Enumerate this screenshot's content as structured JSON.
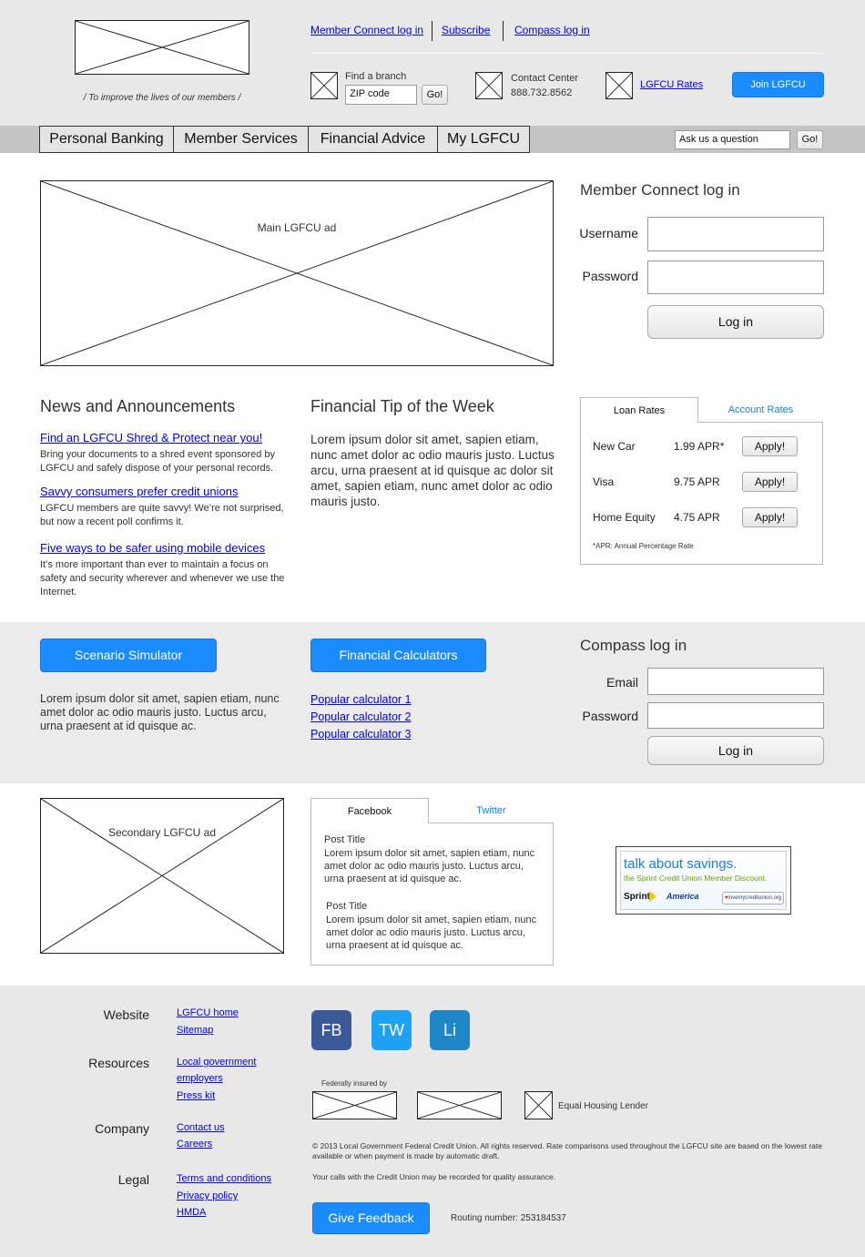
{
  "header": {
    "logo_tagline": "/ To improve the lives of our members /",
    "top_links": [
      "Member Connect log in",
      "Subscribe",
      "Compass log in"
    ],
    "find_branch_label": "Find a branch",
    "zip_value": "ZIP code",
    "go_label": "Go!",
    "contact_center_label": "Contact Center",
    "contact_phone": "888.732.8562",
    "rates_link": "LGFCU Rates",
    "join_label": "Join LGFCU"
  },
  "nav": {
    "items": [
      "Personal Banking",
      "Member Services",
      "Financial Advice",
      "My LGFCU"
    ],
    "ask_value": "Ask us a question",
    "ask_go": "Go!"
  },
  "main_ad": {
    "label": "Main LGFCU ad"
  },
  "member_login": {
    "title": "Member Connect log in",
    "username_label": "Username",
    "password_label": "Password",
    "button": "Log in"
  },
  "news": {
    "title": "News and Announcements",
    "items": [
      {
        "headline": "Find an LGFCU Shred & Protect near you!",
        "body": "Bring your documents to a shred event sponsored by LGFCU and safely dispose of your personal records."
      },
      {
        "headline": "Savvy consumers prefer credit unions",
        "body": "LGFCU members are quite savvy! We’re not surprised, but now a recent poll confirms it."
      },
      {
        "headline": "Five ways to be safer using mobile devices",
        "body": "It’s more important than ever to maintain a focus on safety and security wherever and whenever we use the Internet."
      }
    ]
  },
  "tip": {
    "title": "Financial Tip of the Week",
    "body": "Lorem ipsum dolor sit amet, sapien etiam, nunc amet dolor ac odio mauris justo. Luctus arcu, urna praesent at id quisque ac dolor sit amet, sapien etiam, nunc amet dolor ac odio mauris justo."
  },
  "rates": {
    "tab_active": "Loan Rates",
    "tab_inactive": "Account Rates",
    "rows": [
      {
        "name": "New Car",
        "rate": "1.99 APR*",
        "button": "Apply!"
      },
      {
        "name": "Visa",
        "rate": "9.75 APR",
        "button": "Apply!"
      },
      {
        "name": "Home Equity",
        "rate": "4.75 APR",
        "button": "Apply!"
      }
    ],
    "footnote": "*APR: Annual Percentage Rate"
  },
  "tools": {
    "simulator_label": "Scenario Simulator",
    "simulator_body": "Lorem ipsum dolor sit amet, sapien etiam, nunc amet dolor ac odio mauris justo. Luctus arcu, urna praesent at id quisque ac.",
    "calculators_label": "Financial Calculators",
    "calculator_links": [
      "Popular calculator 1",
      "Popular calculator 2",
      "Popular calculator 3"
    ]
  },
  "compass_login": {
    "title": "Compass log in",
    "email_label": "Email",
    "password_label": "Password",
    "button": "Log in"
  },
  "secondary_ad": {
    "label": "Secondary LGFCU ad"
  },
  "social_feed": {
    "tab_active": "Facebook",
    "tab_inactive": "Twitter",
    "posts": [
      {
        "title": "Post Title",
        "body": "Lorem ipsum dolor sit amet, sapien etiam, nunc amet dolor ac odio mauris justo. Luctus arcu, urna praesent at id quisque ac."
      },
      {
        "title": "Post Title",
        "body": "Lorem ipsum dolor sit amet, sapien etiam, nunc amet dolor ac odio mauris justo. Luctus arcu, urna praesent at id quisque ac."
      }
    ]
  },
  "sprint_ad": {
    "headline": "talk about savings.",
    "sub": "the Sprint Credit Union Member Discount.",
    "logo1": "Sprint",
    "logo2": "America",
    "logo3": "lovemycreditunion.org",
    "colors": {
      "blue": "#1a7de0",
      "green": "#6aa000",
      "yellow": "#f5c400"
    }
  },
  "footer": {
    "groups": [
      {
        "label": "Website",
        "links": [
          "LGFCU home",
          "Sitemap"
        ]
      },
      {
        "label": "Resources",
        "links": [
          "Local government",
          "employers",
          "Press kit"
        ]
      },
      {
        "label": "Company",
        "links": [
          "Contact us",
          "Careers"
        ]
      },
      {
        "label": "Legal",
        "links": [
          "Terms and conditions",
          "Privacy policy",
          "HMDA"
        ]
      }
    ],
    "social": [
      {
        "label": "FB",
        "color": "#3b5998"
      },
      {
        "label": "TW",
        "color": "#1da1f2"
      },
      {
        "label": "Li",
        "color": "#1d87c7"
      }
    ],
    "insured_label": "Federally insured by",
    "equal_housing": "Equal Housing Lender",
    "copyright": "© 2013 Local Government Federal Credit Union. All rights reserved. Rate comparisons used throughout the LGFCU site are based on the lowest rate available or when payment is made by automatic draft.",
    "recording_note": "Your calls with the Credit Union may be recorded for quality assurance.",
    "feedback_label": "Give Feedback",
    "routing": "Routing number: 253184537"
  }
}
